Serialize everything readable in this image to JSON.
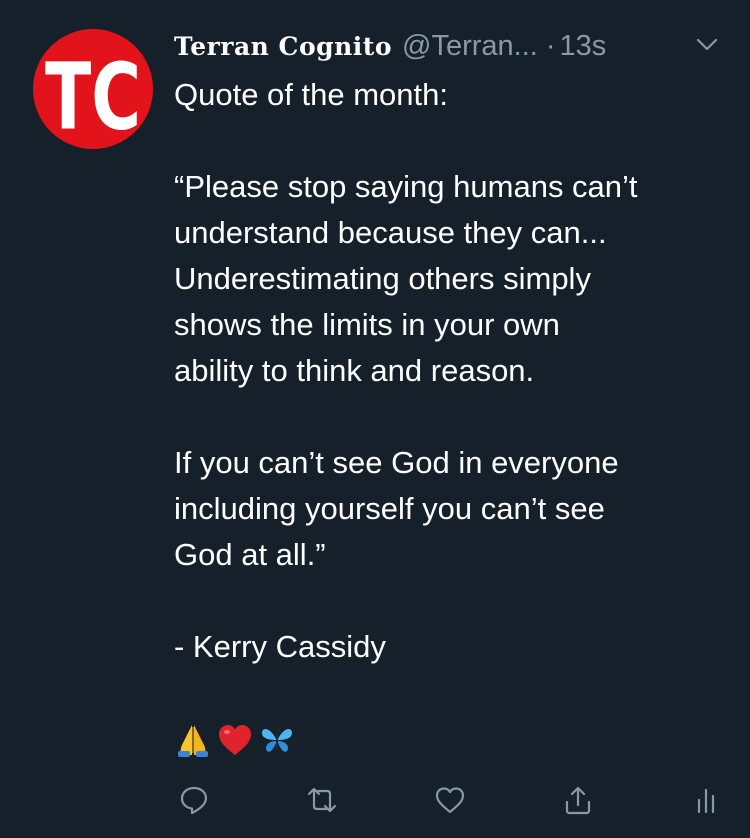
{
  "tweet": {
    "avatar_text": "TC",
    "display_name": "Terran Cognito",
    "handle": "@Terran...",
    "separator": "·",
    "time": "13s",
    "body": {
      "line1": "Quote of the month:",
      "quote_part1": "“Please stop saying humans can’t\nunderstand because they can...\nUnderestimating others simply\nshows the limits in your own\nability to think and reason.",
      "quote_part2": "If you can’t see God in everyone\nincluding yourself you can’t see\nGod at all.”",
      "attribution": "- Kerry Cassidy"
    },
    "emojis": [
      "folded-hands",
      "red-heart",
      "butterfly"
    ],
    "actions": [
      "reply-icon",
      "retweet-icon",
      "like-icon",
      "share-icon",
      "analytics-icon"
    ]
  },
  "colors": {
    "background": "#15202b",
    "secondary_text": "#8899a6",
    "avatar_red": "#e3131b"
  }
}
